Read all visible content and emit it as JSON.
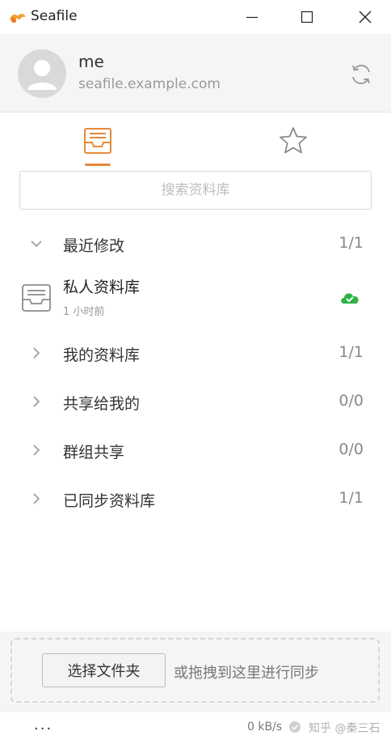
{
  "app": {
    "title": "Seafile"
  },
  "window_controls": {
    "minimize": "minimize",
    "maximize": "maximize",
    "close": "close"
  },
  "account": {
    "name": "me",
    "server": "seafile.example.com"
  },
  "tabs": [
    {
      "id": "repos",
      "icon": "inbox-tray-icon",
      "active": true
    },
    {
      "id": "starred",
      "icon": "star-icon",
      "active": false
    }
  ],
  "search": {
    "placeholder": "搜索资料库"
  },
  "categories": [
    {
      "label": "最近修改",
      "count": "1/1",
      "expanded": true
    },
    {
      "label": "我的资料库",
      "count": "1/1",
      "expanded": false
    },
    {
      "label": "共享给我的",
      "count": "0/0",
      "expanded": false
    },
    {
      "label": "群组共享",
      "count": "0/0",
      "expanded": false
    },
    {
      "label": "已同步资料库",
      "count": "1/1",
      "expanded": false
    }
  ],
  "recent_repo": {
    "name": "私人资料库",
    "time": "1 小时前",
    "status": "synced"
  },
  "drop": {
    "button": "选择文件夹",
    "hint": "或拖拽到这里进行同步"
  },
  "statusbar": {
    "more": "...",
    "rate": "0 kB/s",
    "watermark": "知乎 @秦三石"
  },
  "colors": {
    "accent": "#e58a3c",
    "synced": "#2fb344",
    "account_bg": "#f5f5f7"
  }
}
